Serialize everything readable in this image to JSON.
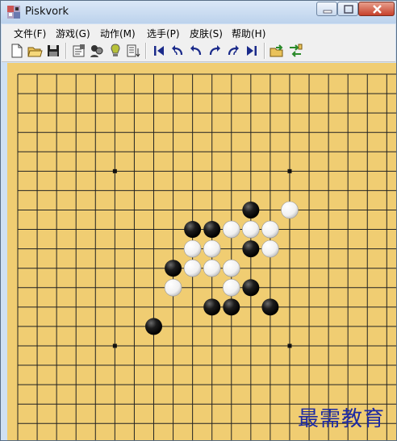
{
  "window": {
    "title": "Piskvork"
  },
  "menu": [
    {
      "label": "文件(F)"
    },
    {
      "label": "游戏(G)"
    },
    {
      "label": "动作(M)"
    },
    {
      "label": "选手(P)"
    },
    {
      "label": "皮肤(S)"
    },
    {
      "label": "帮助(H)"
    }
  ],
  "toolbar": [
    {
      "icon": "new-file-icon"
    },
    {
      "icon": "open-folder-icon"
    },
    {
      "icon": "save-disk-icon"
    },
    {
      "icon": "settings-icon"
    },
    {
      "icon": "players-icon"
    },
    {
      "icon": "hint-bulb-icon"
    },
    {
      "icon": "log-icon"
    },
    {
      "icon": "first-move-icon"
    },
    {
      "icon": "undo-multi-icon"
    },
    {
      "icon": "undo-icon"
    },
    {
      "icon": "redo-icon"
    },
    {
      "icon": "redo-multi-icon"
    },
    {
      "icon": "last-move-icon"
    },
    {
      "icon": "open-engine-icon"
    },
    {
      "icon": "swap-engine-icon"
    }
  ],
  "board": {
    "black_stones": [
      [
        12,
        7
      ],
      [
        9,
        8
      ],
      [
        10,
        8
      ],
      [
        12,
        9
      ],
      [
        8,
        10
      ],
      [
        12,
        11
      ],
      [
        10,
        12
      ],
      [
        11,
        12
      ],
      [
        13,
        12
      ],
      [
        7,
        13
      ]
    ],
    "white_stones": [
      [
        14,
        7
      ],
      [
        11,
        8
      ],
      [
        12,
        8
      ],
      [
        13,
        8
      ],
      [
        9,
        9
      ],
      [
        10,
        9
      ],
      [
        13,
        9
      ],
      [
        9,
        10
      ],
      [
        10,
        10
      ],
      [
        11,
        10
      ],
      [
        8,
        11
      ],
      [
        11,
        11
      ]
    ],
    "star_points": [
      [
        5,
        5
      ],
      [
        14,
        5
      ],
      [
        5,
        14
      ],
      [
        14,
        14
      ]
    ]
  },
  "watermark": "最需教育"
}
